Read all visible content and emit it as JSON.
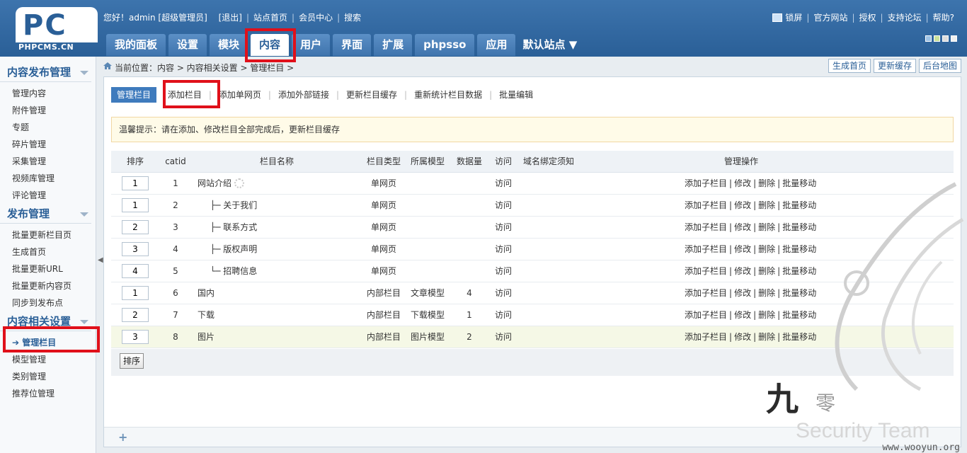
{
  "logo": {
    "mark": "PC",
    "text": "PHPCMS.CN"
  },
  "topbar": {
    "greeting": "您好！admin [超级管理员]",
    "logout": "[退出]",
    "links": [
      "站点首页",
      "会员中心",
      "搜索"
    ],
    "right_links": [
      "锁屏",
      "官方网站",
      "授权",
      "支持论坛",
      "帮助?"
    ]
  },
  "skin_colors": [
    "#9ec3e6",
    "#c9e19a",
    "#dddddd",
    "#f0f0f0"
  ],
  "nav": {
    "tabs": [
      "我的面板",
      "设置",
      "模块",
      "内容",
      "用户",
      "界面",
      "扩展",
      "phpsso",
      "应用"
    ],
    "active": "内容",
    "site_selector": "默认站点"
  },
  "sidebar": {
    "groups": [
      {
        "title": "内容发布管理",
        "items": [
          "管理内容",
          "附件管理",
          "专题",
          "碎片管理",
          "采集管理",
          "视频库管理",
          "评论管理"
        ]
      },
      {
        "title": "发布管理",
        "items": [
          "批量更新栏目页",
          "生成首页",
          "批量更新URL",
          "批量更新内容页",
          "同步到发布点"
        ]
      },
      {
        "title": "内容相关设置",
        "items": [
          "管理栏目",
          "模型管理",
          "类别管理",
          "推荐位管理"
        ]
      }
    ],
    "active_item": "管理栏目"
  },
  "breadcrumb": {
    "text": "当前位置：内容 > 内容相关设置 > 管理栏目 >",
    "buttons": [
      "生成首页",
      "更新缓存",
      "后台地图"
    ]
  },
  "subnav": {
    "items": [
      "管理栏目",
      "添加栏目",
      "添加单网页",
      "添加外部链接",
      "更新栏目缓存",
      "重新统计栏目数据",
      "批量编辑"
    ]
  },
  "tip": "温馨提示：请在添加、修改栏目全部完成后，更新栏目缓存",
  "table": {
    "headers": [
      "排序",
      "catid",
      "栏目名称",
      "栏目类型",
      "所属模型",
      "数据量",
      "访问",
      "域名绑定须知",
      "管理操作"
    ],
    "rows": [
      {
        "order": "1",
        "catid": "1",
        "name": "网站介绍",
        "type": "单网页",
        "model": "",
        "count": "",
        "visit": "访问"
      },
      {
        "order": "1",
        "catid": "2",
        "name": "├─ 关于我们",
        "type": "单网页",
        "model": "",
        "count": "",
        "visit": "访问"
      },
      {
        "order": "2",
        "catid": "3",
        "name": "├─ 联系方式",
        "type": "单网页",
        "model": "",
        "count": "",
        "visit": "访问"
      },
      {
        "order": "3",
        "catid": "4",
        "name": "├─ 版权声明",
        "type": "单网页",
        "model": "",
        "count": "",
        "visit": "访问"
      },
      {
        "order": "4",
        "catid": "5",
        "name": "└─ 招聘信息",
        "type": "单网页",
        "model": "",
        "count": "",
        "visit": "访问"
      },
      {
        "order": "1",
        "catid": "6",
        "name": "国内",
        "type": "内部栏目",
        "model": "文章模型",
        "count": "4",
        "visit": "访问"
      },
      {
        "order": "2",
        "catid": "7",
        "name": "下载",
        "type": "内部栏目",
        "model": "下载模型",
        "count": "1",
        "visit": "访问"
      },
      {
        "order": "3",
        "catid": "8",
        "name": "图片",
        "type": "内部栏目",
        "model": "图片模型",
        "count": "2",
        "visit": "访问"
      }
    ],
    "ops": [
      "添加子栏目",
      "修改",
      "删除",
      "批量移动"
    ]
  },
  "sort_button": "排序",
  "watermark": {
    "site": "www.wooyun.org",
    "team": "Security Team",
    "jiu": "九",
    "ling": "零"
  }
}
